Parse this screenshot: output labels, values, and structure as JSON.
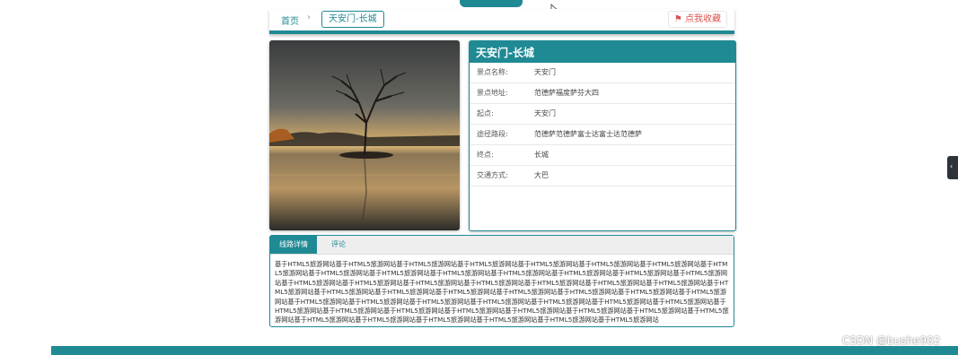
{
  "breadcrumb": {
    "home": "首页",
    "separator": "›",
    "current": "天安门-长城",
    "collect_button": "点我收藏",
    "collect_icon": "flag-icon"
  },
  "scenic": {
    "title": "天安门-长城",
    "rows": [
      {
        "label": "景点名称:",
        "value": "天安门"
      },
      {
        "label": "景点地址:",
        "value": "范德萨福度萨芬大四"
      },
      {
        "label": "起点:",
        "value": "天安门"
      },
      {
        "label": "途径路段:",
        "value": "范德萨范德萨富士达富士达范德萨"
      },
      {
        "label": "终点:",
        "value": "长城"
      },
      {
        "label": "交通方式:",
        "value": "大巴"
      }
    ]
  },
  "detail": {
    "tabs": [
      "线路详情",
      "评论"
    ],
    "active_tab": "线路详情",
    "text": "基于HTML5旅游网站基于HTML5旅游网站基于HTML5旅游网站基于HTML5旅游网站基于HTML5旅游网站基于HTML5旅游网站基于HTML5旅游网站基于HTML5旅游网站基于HTML5旅游网站基于HTML5旅游网站基于HTML5旅游网站基于HTML5旅游网站基于HTML5旅游网站基于HTML5旅游网站基于HTML5旅游网站基于HTML5旅游网站基于HTML5旅游网站基于HTML5旅游网站基于HTML5旅游网站基于HTML5旅游网站基于HTML5旅游网站基于HTML5旅游网站基于HTML5旅游网站基于HTML5旅游网站基于HTML5旅游网站基于HTML5旅游网站基于HTML5旅游网站基于HTML5旅游网站基于HTML5旅游网站基于HTML5旅游网站基于HTML5旅游网站基于HTML5旅游网站基于HTML5旅游网站基于HTML5旅游网站基于HTML5旅游网站基于HTML5旅游网站基于HTML5旅游网站基于HTML5旅游网站基于HTML5旅游网站基于HTML5旅游网站基于HTML5旅游网站基于HTML5旅游网站基于HTML5旅游网站基于HTML5旅游网站基于HTML5旅游网站基于HTML5旅游网站基于HTML5旅游网站基于HTML5旅游网站基于HTML5旅游网站基于HTML5旅游网站基于HTML5旅游网站"
  },
  "side_handle_icon": "chevron-left-icon",
  "watermark": "CSDN @bushe902",
  "colors": {
    "accent": "#1f8a94",
    "collect": "#d9534f"
  }
}
